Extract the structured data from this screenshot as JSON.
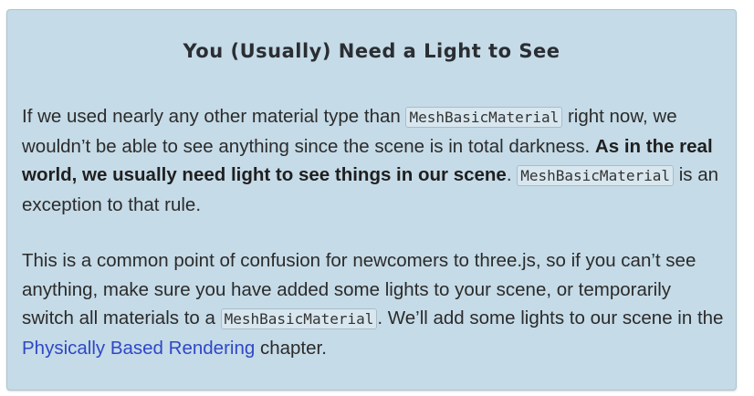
{
  "callout": {
    "title": "You (Usually) Need a Light to See",
    "paragraph1": {
      "text1": "If we used nearly any other material type than ",
      "code1": "MeshBasicMaterial",
      "text2": " right now, we wouldn’t be able to see anything since the scene is in total darkness. ",
      "bold": "As in the real world, we usually need light to see things in our scene",
      "text3": ". ",
      "code2": "MeshBasicMaterial",
      "text4": " is an exception to that rule."
    },
    "paragraph2": {
      "text1": "This is a common point of confusion for newcomers to three.js, so if you can’t see anything, make sure you have added some lights to your scene, or temporarily switch all materials to a ",
      "code1": "MeshBasicMaterial",
      "text2": ". We’ll add some lights to our scene in the ",
      "link": "Physically Based Rendering",
      "text3": " chapter."
    }
  }
}
